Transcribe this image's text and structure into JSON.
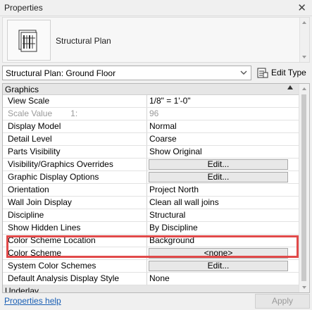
{
  "panel": {
    "title": "Properties",
    "close_glyph": "✕"
  },
  "type_selector": {
    "type_name": "Structural Plan",
    "icon": "structural-plan-icon"
  },
  "instance_selector": {
    "value": "Structural Plan: Ground Floor",
    "edit_type_label": "Edit Type",
    "edit_type_icon": "edit-type-icon"
  },
  "groups": {
    "graphics": "Graphics",
    "underlay": "Underlay"
  },
  "rows": [
    {
      "name": "View Scale",
      "value": "1/8\" = 1'-0\""
    },
    {
      "name": "Scale Value",
      "unit": "1:",
      "value": "96"
    },
    {
      "name": "Display Model",
      "value": "Normal"
    },
    {
      "name": "Detail Level",
      "value": "Coarse"
    },
    {
      "name": "Parts Visibility",
      "value": "Show Original"
    },
    {
      "name": "Visibility/Graphics Overrides",
      "value": "Edit..."
    },
    {
      "name": "Graphic Display Options",
      "value": "Edit..."
    },
    {
      "name": "Orientation",
      "value": "Project North"
    },
    {
      "name": "Wall Join Display",
      "value": "Clean all wall joins"
    },
    {
      "name": "Discipline",
      "value": "Structural"
    },
    {
      "name": "Show Hidden Lines",
      "value": "By Discipline"
    },
    {
      "name": "Color Scheme Location",
      "value": "Background"
    },
    {
      "name": "Color Scheme",
      "value": "<none>"
    },
    {
      "name": "System Color Schemes",
      "value": "Edit..."
    },
    {
      "name": "Default Analysis Display Style",
      "value": "None"
    }
  ],
  "footer": {
    "help_link": "Properties help",
    "apply_label": "Apply"
  },
  "colors": {
    "highlight": "#e14a4a",
    "link": "#1a5fb4",
    "disabled_text": "#9a9a9a"
  }
}
